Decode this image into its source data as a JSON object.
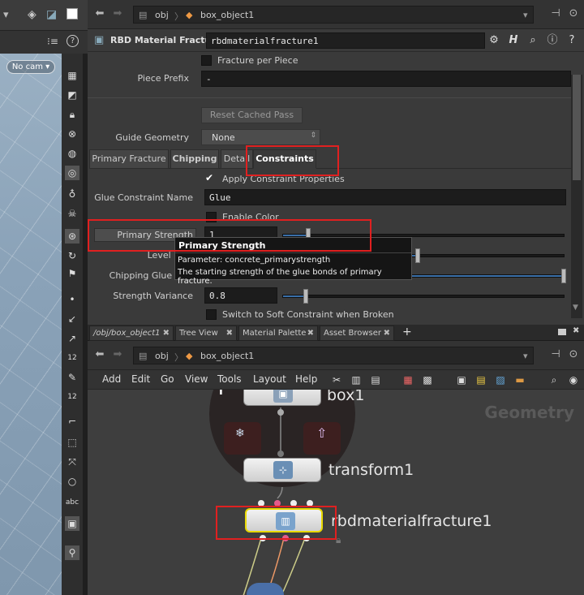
{
  "viewport": {
    "camera_label": "No cam",
    "tool_text": {
      "abc": "abc",
      "num12a": "12",
      "num12b": "12"
    }
  },
  "params_pane": {
    "path": {
      "root": "obj",
      "node": "box_object1"
    },
    "node_type": "RBD Material Fracture",
    "node_name": "rbdmaterialfracture1",
    "fracture_per_piece": "Fracture per Piece",
    "piece_prefix": {
      "label": "Piece Prefix",
      "value": "-"
    },
    "reset_cached_pass": "Reset Cached Pass",
    "guide_geometry": {
      "label": "Guide Geometry",
      "value": "None"
    },
    "tabs": [
      "Primary Fracture",
      "Chipping",
      "Detail",
      "Constraints"
    ],
    "apply_constraint": "Apply Constraint Properties",
    "glue_constraint_name": {
      "label": "Glue Constraint Name",
      "value": "Glue"
    },
    "enable_color": "Enable Color",
    "primary_strength": {
      "label": "Primary Strength",
      "value": "1",
      "fraction": 0.09
    },
    "level_mult": {
      "label": "Level Mult",
      "fraction": 0.48
    },
    "chipping_glue": {
      "label": "Chipping Glue Stre",
      "fraction": 1.0
    },
    "strength_variance": {
      "label": "Strength Variance",
      "value": "0.8",
      "fraction": 0.08
    },
    "switch_soft": "Switch to Soft Constraint when Broken",
    "tooltip": {
      "title": "Primary Strength",
      "line1": "Parameter: concrete_primarystrength",
      "line2": "The starting strength of the glue bonds of primary fracture."
    }
  },
  "pane_tabs": [
    "/obj/box_object1",
    "Tree View",
    "Material Palette",
    "Asset Browser"
  ],
  "network": {
    "path": {
      "root": "obj",
      "node": "box_object1"
    },
    "menus": [
      "Add",
      "Edit",
      "Go",
      "View",
      "Tools",
      "Layout",
      "Help"
    ],
    "context_label": "Geometry",
    "nodes": [
      {
        "name": "box1"
      },
      {
        "name": "transform1"
      },
      {
        "name": "rbdmaterialfracture1"
      }
    ],
    "info_glyph": "i"
  },
  "colors": {
    "highlight": "#e02020",
    "slider": "#3a6fa8",
    "selected_node": "#e8d800"
  }
}
